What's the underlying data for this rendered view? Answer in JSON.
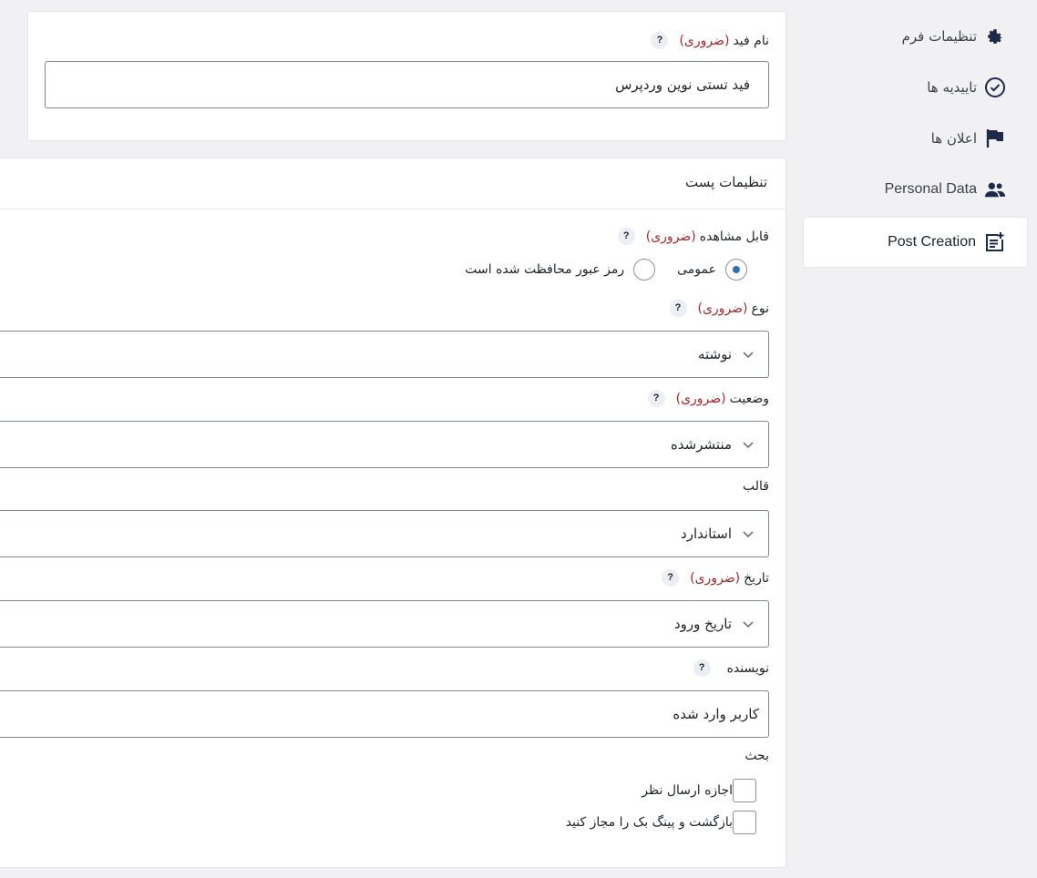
{
  "feed_card": {
    "label": "نام فید",
    "required": "(ضروری)",
    "help": "?",
    "value": "فید تستی نوین وردپرس"
  },
  "post_settings": {
    "title": "تنظیمات پست",
    "visibility": {
      "label": "قابل مشاهده",
      "required": "(ضروری)",
      "help": "?",
      "options": [
        {
          "label": "عمومی",
          "checked": true
        },
        {
          "label": "رمز عبور محافظت شده است",
          "checked": false
        }
      ]
    },
    "type": {
      "label": "نوع",
      "required": "(ضروری)",
      "help": "?",
      "value": "نوشته"
    },
    "status": {
      "label": "وضعیت",
      "required": "(ضروری)",
      "help": "?",
      "value": "منتشرشده"
    },
    "template": {
      "label": "قالب",
      "value": "استاندارد"
    },
    "date": {
      "label": "تاریخ",
      "required": "(ضروری)",
      "help": "?",
      "value": "تاریخ ورود"
    },
    "author": {
      "label": "نویسنده",
      "help": "?",
      "value": "کاربر وارد شده"
    },
    "discussion": {
      "label": "بحث",
      "options": [
        {
          "label": "اجازه ارسال نظر",
          "checked": false
        },
        {
          "label": "بازگشت و پینگ بک را مجاز کنید",
          "checked": false
        }
      ]
    }
  },
  "sidebar": {
    "items": [
      {
        "label": "تنظیمات فرم",
        "icon": "gear-icon"
      },
      {
        "label": "تاییدیه ها",
        "icon": "check-circle-icon"
      },
      {
        "label": "اعلان ها",
        "icon": "flag-icon"
      },
      {
        "label": "Personal Data",
        "icon": "users-icon"
      },
      {
        "label": "Post Creation",
        "icon": "post-add-icon",
        "active": true
      }
    ]
  },
  "colors": {
    "accent": "#2f6db5",
    "required": "#a4262c",
    "icon": "#1e2a4a"
  }
}
